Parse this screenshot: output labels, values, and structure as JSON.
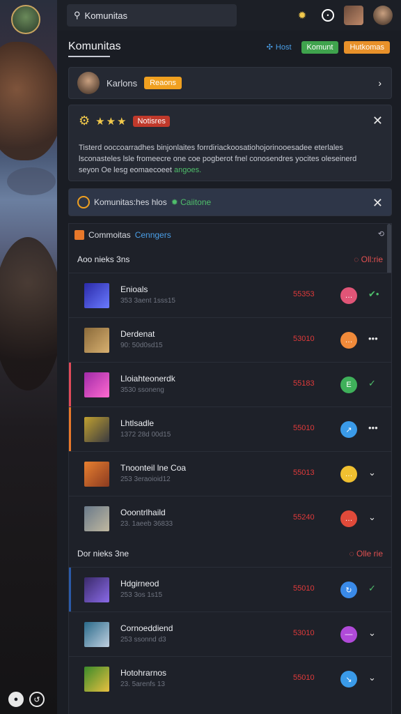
{
  "search": {
    "value": "Komunitas"
  },
  "page": {
    "title": "Komunitas"
  },
  "title_buttons": {
    "link": "Host",
    "green": "Komunt",
    "orange": "Hutkomas"
  },
  "profile": {
    "name": "Karlons",
    "badge": "Reaons"
  },
  "notice": {
    "badge": "Notisres",
    "line1": "Tisterd ooccoarradhes binjonlaites forrdiriackoosatiohojorinooesadee eterlales",
    "line2": "lsconasteles lsle fromeecre one coe pogberot fnel conosendres yocites oleseinerd",
    "line3_plain": "seyon Oe lesg eomaecoeet",
    "line3_highlight": "angoes."
  },
  "banner": {
    "text": "Komunitas:hes hlos",
    "status": "Caiitone"
  },
  "panel": {
    "title": "Commoitas",
    "title_blue": "Cenngers"
  },
  "groups": [
    {
      "label": "Aoo nieks 3ns",
      "status": "Oll:rie",
      "rows": [
        {
          "name": "Enioals",
          "sub": "353 3aent 1sss15",
          "score": "55353",
          "bubble_color": "#e05577",
          "bubble_icon": "…",
          "action": "✔•",
          "action_green": true,
          "accent": "",
          "thumb": "linear-gradient(135deg,#2a2aa8,#6a7aff)"
        },
        {
          "name": "Derdenat",
          "sub": "90: 50d0sd15",
          "score": "53010",
          "bubble_color": "#f08a3a",
          "bubble_icon": "…",
          "action": "•••",
          "action_green": false,
          "accent": "",
          "thumb": "linear-gradient(135deg,#8a6a3a,#d8b070)"
        },
        {
          "name": "Lloiahteonerdk",
          "sub": "3530 ssoneng",
          "score": "55183",
          "bubble_color": "#3fb05a",
          "bubble_icon": "E",
          "action": "✓",
          "action_green": true,
          "accent": "#e04a5a",
          "thumb": "linear-gradient(135deg,#a02aa8,#ff6ad0)"
        },
        {
          "name": "Lhtlsadle",
          "sub": "1372 28d 00d15",
          "score": "55010",
          "bubble_color": "#3a9ae8",
          "bubble_icon": "↗",
          "action": "•••",
          "action_green": false,
          "accent": "#e8782a",
          "thumb": "linear-gradient(135deg,#c0a030,#3a3a40)"
        },
        {
          "name": "Tnoonteil lne Coa",
          "sub": "253 3eraoioid12",
          "score": "55013",
          "bubble_color": "#f0c030",
          "bubble_icon": "…",
          "action": "⌄",
          "action_green": false,
          "accent": "",
          "thumb": "linear-gradient(135deg,#e88030,#8a3a20)"
        },
        {
          "name": "Ooontrlhaild",
          "sub": "23. 1aeeb 36833",
          "score": "55240",
          "bubble_color": "#e04a3a",
          "bubble_icon": "…",
          "action": "⌄",
          "action_green": false,
          "accent": "",
          "thumb": "linear-gradient(135deg,#6a7a8a,#c0b8a0)"
        }
      ]
    },
    {
      "label": "Dor nieks 3ne",
      "status": "Olle rie",
      "rows": [
        {
          "name": "Hdgirneod",
          "sub": "253 3os 1s15",
          "score": "55010",
          "bubble_color": "#3a8ae8",
          "bubble_icon": "↻",
          "action": "✓",
          "action_green": true,
          "accent": "#2a5aa8",
          "thumb": "linear-gradient(135deg,#3a2a6a,#8a6ae8)"
        },
        {
          "name": "Cornoeddiend",
          "sub": "253 ssonnd d3",
          "score": "53010",
          "bubble_color": "#b04ad8",
          "bubble_icon": "—",
          "action": "⌄",
          "action_green": false,
          "accent": "",
          "thumb": "linear-gradient(135deg,#2a6a8a,#c0d0e0)"
        },
        {
          "name": "Hotohrarnos",
          "sub": "23. 5arenfs 13",
          "score": "55010",
          "bubble_color": "#3a9ae8",
          "bubble_icon": "↘",
          "action": "⌄",
          "action_green": false,
          "accent": "",
          "thumb": "linear-gradient(135deg,#3a8a2a,#e8c040)"
        }
      ]
    }
  ]
}
